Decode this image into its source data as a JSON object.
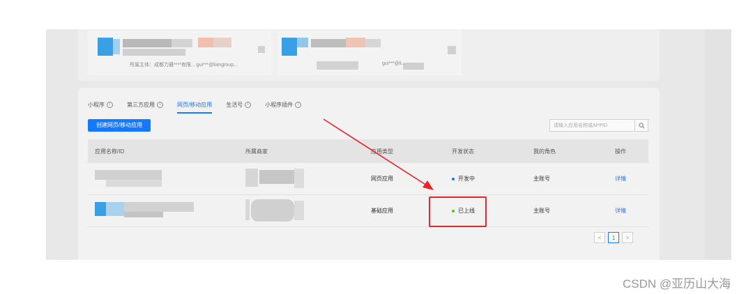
{
  "top_cards": [
    {
      "meta": "所属主体：成都力雅****有限...  gui***@liangroup..."
    },
    {
      "meta": "gui***@li..."
    }
  ],
  "tabs": [
    {
      "label": "小程序",
      "active": false,
      "info": true
    },
    {
      "label": "第三方应用",
      "active": false,
      "info": true
    },
    {
      "label": "网页/移动应用",
      "active": true,
      "info": false
    },
    {
      "label": "生活号",
      "active": false,
      "info": true
    },
    {
      "label": "小程序插件",
      "active": false,
      "info": true
    }
  ],
  "create_button": "创建网页/移动应用",
  "search": {
    "placeholder": "请输入应用名称或APPID"
  },
  "table": {
    "headers": [
      "应用名称/ID",
      "所属商家",
      "应用类型",
      "开发状态",
      "我的角色",
      "操作"
    ],
    "rows": [
      {
        "type": "网页应用",
        "status": "开发中",
        "status_color": "#1677ff",
        "role": "主账号",
        "action": "详情"
      },
      {
        "type": "基础应用",
        "status": "已上线",
        "status_color": "#52c41a",
        "role": "主账号",
        "action": "详情"
      }
    ]
  },
  "pagination": {
    "prev": "<",
    "current": "1",
    "next": ">"
  },
  "annotation": {
    "color": "#e8242a"
  },
  "watermark": "CSDN @亚历山大海"
}
